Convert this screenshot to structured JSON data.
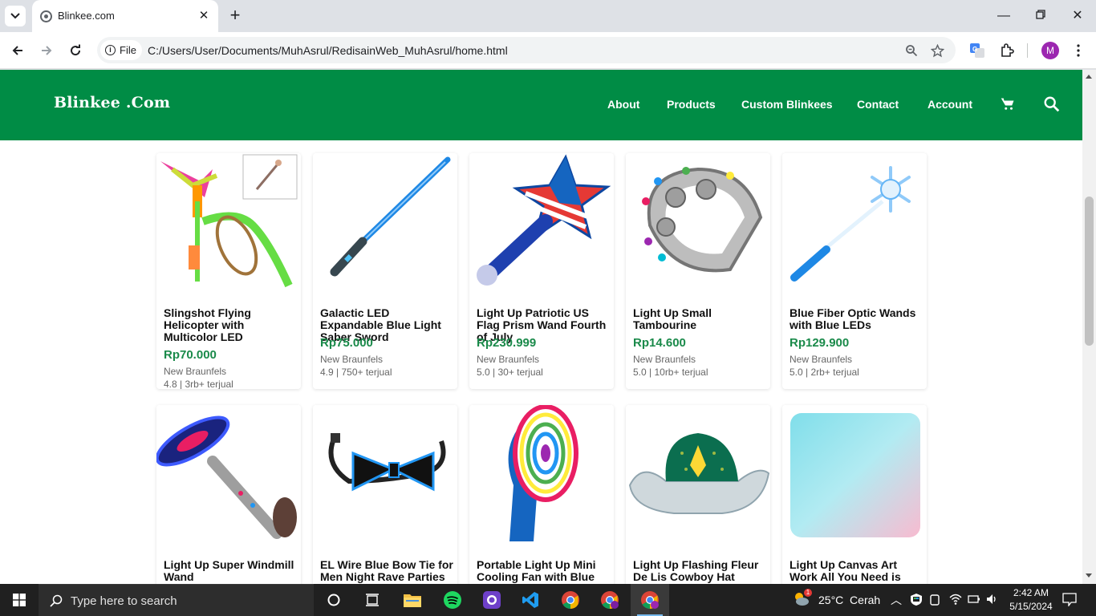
{
  "browser": {
    "tab_title": "Blinkee.com",
    "site_chip": "File",
    "url": "C:/Users/User/Documents/MuhAsrul/RedisainWeb_MuhAsrul/home.html",
    "profile_initial": "M"
  },
  "site": {
    "logo": "Blinkee .Com",
    "nav": [
      "About",
      "Products",
      "Custom Blinkees",
      "Contact",
      "Account"
    ],
    "colors": {
      "header": "#008c45",
      "price": "#1a8a4a"
    }
  },
  "products": [
    {
      "name": "Slingshot Flying Helicopter with Multicolor LED",
      "price": "Rp70.000",
      "location": "New Braunfels",
      "rating": "4.8 | 3rb+ terjual"
    },
    {
      "name": "Galactic LED Expandable Blue Light Saber Sword",
      "price": "Rp75.000",
      "location": "New Braunfels",
      "rating": "4.9 | 750+ terjual"
    },
    {
      "name": "Light Up Patriotic US Flag Prism Wand Fourth of July",
      "price": "Rp230.999",
      "location": "New Braunfels",
      "rating": "5.0 | 30+ terjual"
    },
    {
      "name": "Light Up Small Tambourine",
      "price": "Rp14.600",
      "location": "New Braunfels",
      "rating": "5.0 | 10rb+ terjual"
    },
    {
      "name": "Blue Fiber Optic Wands with Blue LEDs",
      "price": "Rp129.900",
      "location": "New Braunfels",
      "rating": "5.0 | 2rb+ terjual"
    },
    {
      "name": "Light Up Super Windmill Wand"
    },
    {
      "name": "EL Wire Blue Bow Tie for Men Night Rave Parties"
    },
    {
      "name": "Portable Light Up Mini Cooling Fan with Blue Handle"
    },
    {
      "name": "Light Up Flashing Fleur De Lis Cowboy Hat"
    },
    {
      "name": "Light Up Canvas Art Work All You Need is Love"
    }
  ],
  "taskbar": {
    "search_placeholder": "Type here to search",
    "weather": "25°C  Cerah",
    "weather_badge": "1",
    "time": "2:42 AM",
    "date": "5/15/2024"
  }
}
